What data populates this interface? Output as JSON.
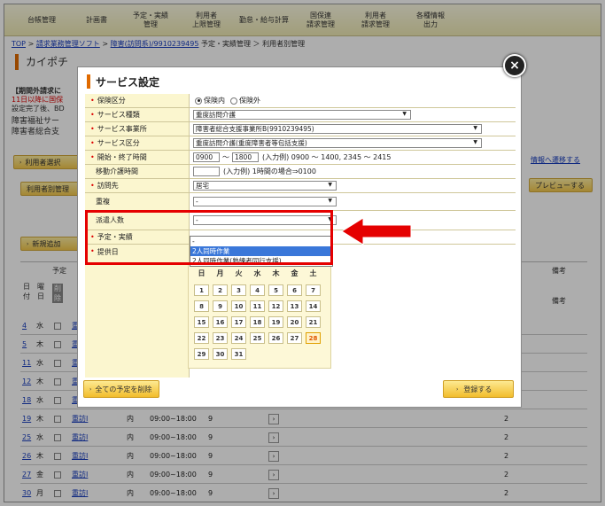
{
  "topnav": [
    "台帳管理",
    "計画書",
    "予定・実績\n管理",
    "利用者\n上限管理",
    "勤怠・給与計算",
    "国保連\n請求管理",
    "利用者\n請求管理",
    "各種情報\n出力"
  ],
  "breadcrumb": {
    "top": "TOP",
    "sep": ">",
    "link1": "請求業務管理ソフト",
    "link2": "障害(訪問系)/9910239495",
    "rest": "予定・実績管理  ＞  利用者別管理"
  },
  "page_title": "カイポチ",
  "bg": {
    "notice1": "【期間外請求に",
    "notice2": "11日以降に国保",
    "notice3": "設定完了後、BD",
    "office1": "障害福祉サー",
    "office2": "障害者総合支",
    "btn_select": "利用者選択",
    "btn_user_mgmt": "利用者別管理",
    "btn_new": "新規追加",
    "right_link": "情報へ遷移する",
    "btn_preview": "プレビューする",
    "col_plan": "予定",
    "col_day": "日\n付",
    "col_week": "曜\n日",
    "col_delete": "削\n除",
    "col_note": "備考",
    "col_note2": "備考"
  },
  "bg_rows": [
    {
      "day": "4",
      "wd": "水",
      "svc": "重"
    },
    {
      "day": "5",
      "wd": "木",
      "svc": "重"
    },
    {
      "day": "11",
      "wd": "水",
      "svc": "重"
    },
    {
      "day": "12",
      "wd": "木",
      "svc": "重"
    },
    {
      "day": "18",
      "wd": "水",
      "svc": "重"
    },
    {
      "day": "19",
      "wd": "木",
      "svc": "重訪Ⅰ",
      "loc": "内",
      "time": "09:00~18:00",
      "h": "9",
      "n": "2"
    },
    {
      "day": "25",
      "wd": "水",
      "svc": "重訪Ⅰ",
      "loc": "内",
      "time": "09:00~18:00",
      "h": "9",
      "n": "2"
    },
    {
      "day": "26",
      "wd": "木",
      "svc": "重訪Ⅰ",
      "loc": "内",
      "time": "09:00~18:00",
      "h": "9",
      "n": "2"
    },
    {
      "day": "27",
      "wd": "金",
      "svc": "重訪Ⅰ",
      "loc": "内",
      "time": "09:00~18:00",
      "h": "9",
      "n": "2"
    },
    {
      "day": "30",
      "wd": "月",
      "svc": "重訪Ⅰ",
      "loc": "内",
      "time": "09:00~18:00",
      "h": "9",
      "n": "2"
    }
  ],
  "modal": {
    "title": "サービス設定",
    "close": "×",
    "rows": {
      "insurance": {
        "label": "保険区分",
        "opt_in": "保険内",
        "opt_out": "保険外"
      },
      "service_type": {
        "label": "サービス種類",
        "value": "重度訪問介護"
      },
      "office": {
        "label": "サービス事業所",
        "value": "障害者総合支援事業所B(9910239495)"
      },
      "category": {
        "label": "サービス区分",
        "value": "重度訪問介護(重度障害者等包括支援)"
      },
      "time": {
        "label": "開始・終了時間",
        "start": "0900",
        "tilde": "～",
        "end": "1800",
        "hint": "(入力例) 0900 ～ 1400, 2345 ～ 2415"
      },
      "move": {
        "label": "移動介護時間",
        "hint": "(入力例) 1時間の場合⇒0100"
      },
      "visit": {
        "label": "訪問先",
        "value": "居宅"
      },
      "overlap": {
        "label": "重複",
        "value": "-"
      },
      "staff": {
        "label": "派遣人数",
        "value": "-"
      },
      "plan": {
        "label": "予定・実績"
      },
      "offer": {
        "label": "提供日"
      }
    },
    "dropdown": [
      "-",
      "2人同時作業",
      "2人同時作業(熟練者同行支援)"
    ],
    "calendar": {
      "weekdays": [
        "日",
        "月",
        "火",
        "水",
        "木",
        "金",
        "土"
      ],
      "days": [
        [
          "1",
          "2",
          "3",
          "4",
          "5",
          "6",
          "7"
        ],
        [
          "8",
          "9",
          "10",
          "11",
          "12",
          "13",
          "14"
        ],
        [
          "15",
          "16",
          "17",
          "18",
          "19",
          "20",
          "21"
        ],
        [
          "22",
          "23",
          "24",
          "25",
          "26",
          "27",
          "28"
        ],
        [
          "29",
          "30",
          "31"
        ]
      ],
      "highlight": "28"
    },
    "btn_delete_all": "全ての予定を削除",
    "btn_register": "登録する"
  }
}
